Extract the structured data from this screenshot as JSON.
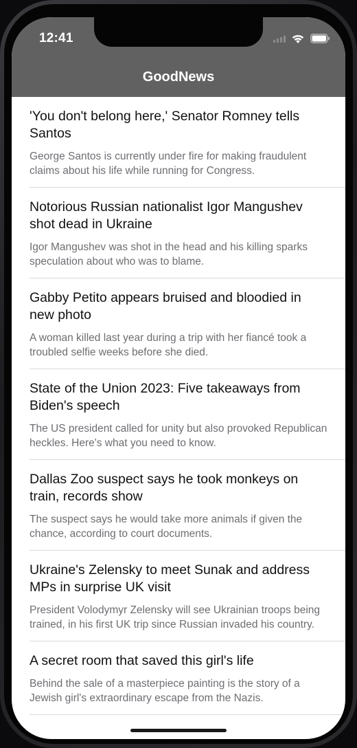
{
  "status_bar": {
    "time": "12:41"
  },
  "nav": {
    "title": "GoodNews"
  },
  "articles": [
    {
      "title": "'You don't belong here,' Senator Romney tells Santos",
      "summary": "George Santos is currently under fire for making fraudulent claims about his life while running for Congress."
    },
    {
      "title": "Notorious Russian nationalist Igor Mangushev shot dead in Ukraine",
      "summary": "Igor Mangushev was shot in the head and his killing sparks speculation about who was to blame."
    },
    {
      "title": "Gabby Petito appears bruised and bloodied in new photo",
      "summary": "A woman killed last year during a trip with her fiancé took a troubled selfie weeks before she died."
    },
    {
      "title": "State of the Union 2023: Five takeaways from Biden's speech",
      "summary": "The US president called for unity but also provoked Republican heckles. Here's what you need to know."
    },
    {
      "title": "Dallas Zoo suspect says he took monkeys on train, records show",
      "summary": "The suspect says he would take more animals if given the chance, according to court documents."
    },
    {
      "title": "Ukraine's Zelensky to meet Sunak and address MPs in surprise UK visit",
      "summary": "President Volodymyr Zelensky will see Ukrainian troops being trained, in his first UK trip since Russian invaded his country."
    },
    {
      "title": "A secret room that saved this girl's life",
      "summary": "Behind the sale of a masterpiece painting is the story of a Jewish girl's extraordinary escape from the Nazis."
    }
  ],
  "colors": {
    "nav_background": "#616161",
    "title_text": "#111111",
    "summary_text": "#6e6e73",
    "separator": "#d9d9d9"
  },
  "icons": [
    "cellular-signal-icon",
    "wifi-icon",
    "battery-icon"
  ]
}
